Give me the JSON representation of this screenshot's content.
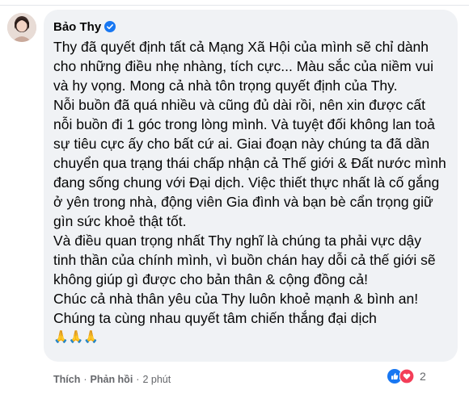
{
  "comment": {
    "author": "Bảo Thy",
    "paragraphs": [
      "Thy đã quyết định tất cả Mạng Xã Hội của mình sẽ chỉ dành cho những điều nhẹ nhàng, tích cực... Màu sắc của niềm vui và hy vọng. Mong cả nhà tôn trọng quyết định của Thy.",
      "Nỗi buồn đã quá nhiều và cũng đủ dài rồi, nên xin được cất nỗi buồn đi 1 góc trong lòng mình. Và tuyệt đối không lan toả sự tiêu cực ấy cho bất cứ ai. Giai đoạn này chúng ta đã dần chuyển qua trạng thái chấp nhận cả Thế giới & Đất nước mình đang sống chung với Đại dịch. Việc thiết thực nhất là cố gắng ở yên trong nhà, động viên Gia đình và bạn bè cẩn trọng giữ gìn sức khoẻ thật tốt.",
      "Và điều quan trọng nhất Thy nghĩ là chúng ta phải vực dậy tinh thần của chính mình, vì buồn chán hay dỗi cả thế giới sẽ không giúp gì được cho bản thân & cộng đồng cả!",
      "Chúc cả nhà thân yêu của Thy luôn khoẻ mạnh & bình an! Chúng ta cùng nhau quyết tâm chiến thắng đại dịch"
    ],
    "emojis": "🙏🙏🙏"
  },
  "actions": {
    "like": "Thích",
    "separator1": "·",
    "reply": "Phản hồi",
    "separator2": "·",
    "time": "2 phút"
  },
  "reactions": {
    "count": "2",
    "types": [
      "like",
      "love"
    ]
  },
  "colors": {
    "bubble": "#f0f2f5",
    "text": "#050505",
    "secondary": "#65676b",
    "verified": "#1877f2",
    "like": "#1877f2",
    "love": "#f33e58"
  }
}
